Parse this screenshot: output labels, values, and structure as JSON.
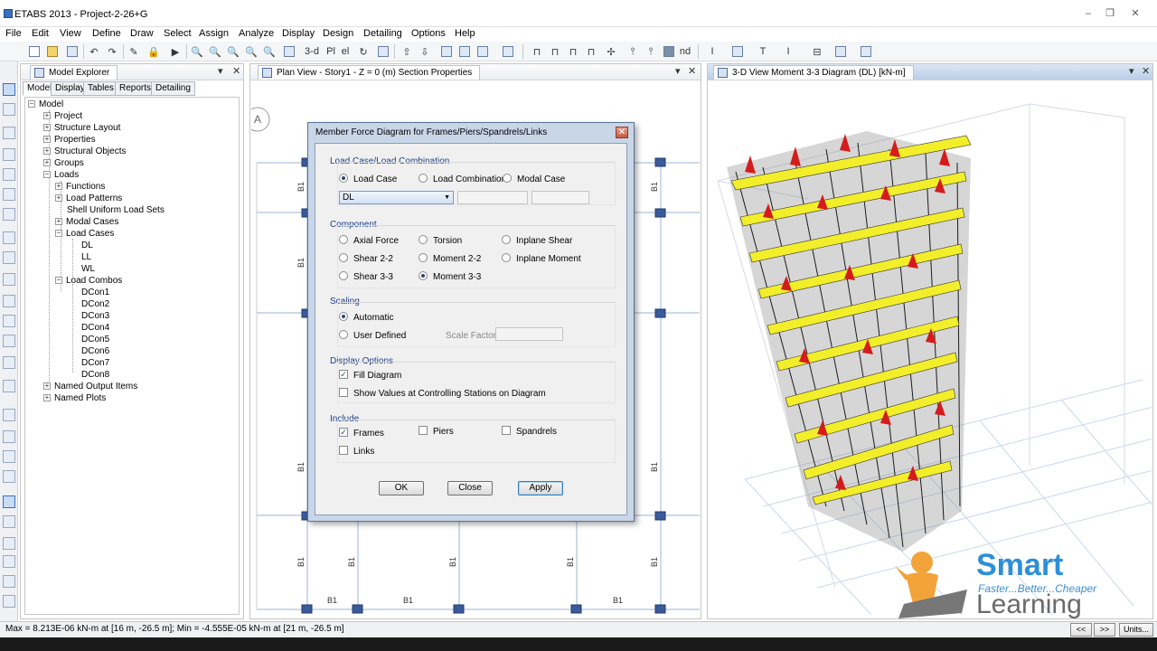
{
  "app": {
    "title": "ETABS 2013  - Project-2-26+G"
  },
  "menu": [
    "File",
    "Edit",
    "View",
    "Define",
    "Draw",
    "Select",
    "Assign",
    "Analyze",
    "Display",
    "Design",
    "Detailing",
    "Options",
    "Help"
  ],
  "toolbar": {
    "view3d_label": "3-d",
    "pl_label": "Pl",
    "el_label": "el",
    "nd_label": "nd"
  },
  "model_explorer": {
    "title": "Model Explorer",
    "tabs": [
      "Model",
      "Display",
      "Tables",
      "Reports",
      "Detailing"
    ],
    "tree": {
      "root": "Model",
      "project": "Project",
      "structure_layout": "Structure Layout",
      "properties": "Properties",
      "structural_objects": "Structural Objects",
      "groups": "Groups",
      "loads": "Loads",
      "functions": "Functions",
      "load_patterns": "Load Patterns",
      "shell_uniform": "Shell Uniform Load Sets",
      "modal_cases": "Modal Cases",
      "load_cases": "Load Cases",
      "load_case_items": [
        "DL",
        "LL",
        "WL"
      ],
      "load_combos": "Load Combos",
      "combo_items": [
        "DCon1",
        "DCon2",
        "DCon3",
        "DCon4",
        "DCon5",
        "DCon6",
        "DCon7",
        "DCon8"
      ],
      "named_output": "Named Output Items",
      "named_plots": "Named Plots"
    }
  },
  "plan_view": {
    "title": "Plan View - Story1 - Z = 0 (m)  Section Properties",
    "grid_bubble": "A",
    "beam_label": "B1"
  },
  "view3d": {
    "title": "3-D View    Moment 3-3 Diagram    (DL)  [kN-m]"
  },
  "dialog": {
    "title": "Member Force Diagram for Frames/Piers/Spandrels/Links",
    "load_group_title": "Load Case/Load Combination",
    "load_case": "Load Case",
    "load_combination": "Load Combination",
    "modal_case": "Modal Case",
    "selected_case": "DL",
    "component_title": "Component",
    "axial_force": "Axial Force",
    "torsion": "Torsion",
    "inplane_shear": "Inplane Shear",
    "shear22": "Shear 2-2",
    "moment22": "Moment 2-2",
    "inplane_moment": "Inplane Moment",
    "shear33": "Shear 3-3",
    "moment33": "Moment 3-3",
    "scaling_title": "Scaling",
    "automatic": "Automatic",
    "user_defined": "User Defined",
    "scale_factor": "Scale Factor",
    "display_title": "Display Options",
    "fill_diagram": "Fill Diagram",
    "show_values": "Show Values at Controlling Stations on Diagram",
    "include_title": "Include",
    "frames": "Frames",
    "piers": "Piers",
    "spandrels": "Spandrels",
    "links": "Links",
    "ok": "OK",
    "close": "Close",
    "apply": "Apply"
  },
  "status": {
    "text": "Max = 8.213E-06 kN-m at [16 m, -26.5 m];  Min = -4.555E-05 kN-m at [21 m, -26.5 m]",
    "prev": "<<",
    "next": ">>",
    "units": "Units..."
  },
  "logo": {
    "smart": "Smart",
    "tagline": "Faster...Better...Cheaper",
    "learning": "Learning"
  },
  "colors": {
    "accent": "#3a70c0",
    "diagram_fill": "#f2ee2a",
    "diagram_neg": "#d41c1c",
    "group_title": "#1a3e8a"
  }
}
